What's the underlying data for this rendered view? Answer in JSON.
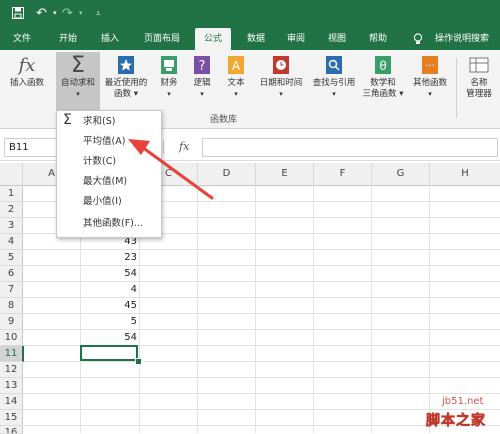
{
  "colors": {
    "accent": "#217346",
    "arrow": "#e8413a",
    "watermark": "#d9534f"
  },
  "tabs": [
    "文件",
    "开始",
    "插入",
    "页面布局",
    "公式",
    "数据",
    "审阅",
    "视图",
    "帮助",
    "操作说明搜索"
  ],
  "active_tab": "公式",
  "ribbon": {
    "buttons": [
      {
        "label": "插入函数",
        "icon": "fx-icon"
      },
      {
        "label": "自动求和",
        "icon": "sigma-icon"
      },
      {
        "label": "最近使用的\n函数",
        "icon": "star-book-icon"
      },
      {
        "label": "财务",
        "icon": "finance-book-icon"
      },
      {
        "label": "逻辑",
        "icon": "question-book-icon"
      },
      {
        "label": "文本",
        "icon": "text-book-icon"
      },
      {
        "label": "日期和时间",
        "icon": "clock-book-icon"
      },
      {
        "label": "查找与引用",
        "icon": "lookup-book-icon"
      },
      {
        "label": "数学和\n三角函数",
        "icon": "theta-book-icon"
      },
      {
        "label": "其他函数",
        "icon": "more-book-icon"
      },
      {
        "label": "名称\n管理器",
        "icon": "name-manager-icon"
      }
    ],
    "group_label": "函数库"
  },
  "namebox": "B11",
  "fx_label": "fx",
  "columns": [
    "A",
    "B",
    "C",
    "D",
    "E",
    "F",
    "G",
    "H"
  ],
  "rows": [
    "1",
    "2",
    "3",
    "4",
    "5",
    "6",
    "7",
    "8",
    "9",
    "10",
    "11",
    "12",
    "13",
    "14",
    "15",
    "16"
  ],
  "cell_values": [
    "43",
    "23",
    "54",
    "4",
    "45",
    "5",
    "54"
  ],
  "dropdown": {
    "items": [
      "求和(S)",
      "平均值(A)",
      "计数(C)",
      "最大值(M)",
      "最小值(I)",
      "其他函数(F)..."
    ]
  },
  "watermark": {
    "site": "jb51.net",
    "brand": "脚本之家"
  }
}
